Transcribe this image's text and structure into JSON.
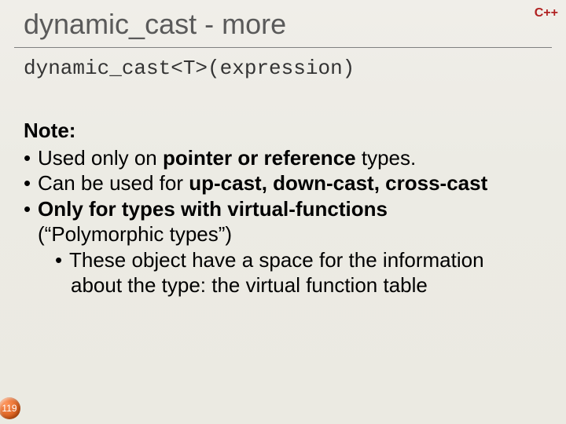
{
  "badge": "C++",
  "title": "dynamic_cast - more",
  "code": "dynamic_cast<T>(expression)",
  "noteLabel": "Note:",
  "b1_pre": "Used only on ",
  "b1_bold": "pointer or reference",
  "b1_post": " types.",
  "b2_pre": "Can be used for ",
  "b2_bold": "up-cast, down-cast, cross-cast",
  "b3_bold": "Only for types with virtual-functions",
  "b3_sub": "(“Polymorphic types”)",
  "b4_line1": "These object have a space for the information",
  "b4_line2": "about the type: the virtual function table",
  "pageNumber": "119"
}
